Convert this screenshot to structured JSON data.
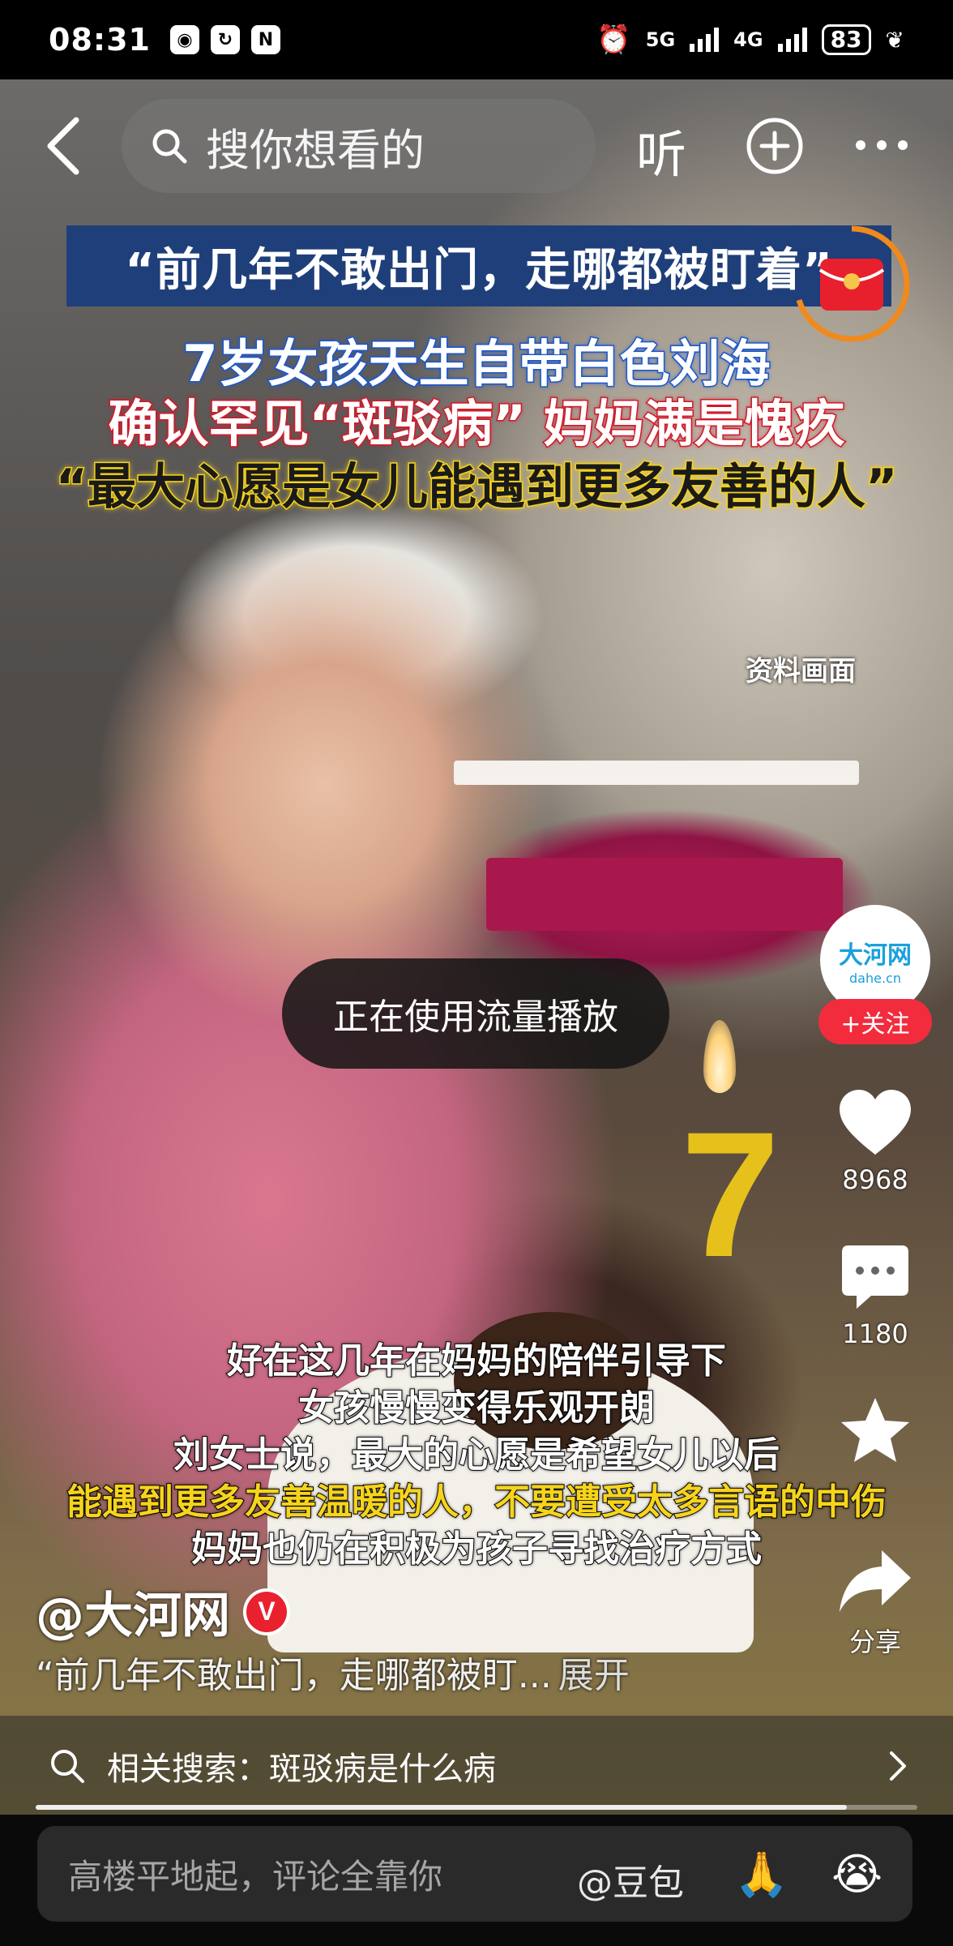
{
  "status": {
    "time": "08:31",
    "network1": "5G",
    "network2": "4G",
    "battery": "83"
  },
  "nav": {
    "search_placeholder": "搜你想看的",
    "listen_label": "听"
  },
  "overlay": {
    "headline": "“前几年不敢出门，走哪都被盯着”",
    "line1": "7岁女孩天生自带白色刘海",
    "line2": "确认罕见“斑驳病” 妈妈满是愧疚",
    "line3": "“最大心愿是女儿能遇到更多友善的人”",
    "source": "资料画面",
    "candle_number": "7"
  },
  "toast": "正在使用流量播放",
  "rail": {
    "avatar_logo": "大河网",
    "avatar_sub": "dahe.cn",
    "follow_label": "+关注",
    "likes": "8968",
    "comments": "1180",
    "share_label": "分享"
  },
  "subtitles": [
    "好在这几年在妈妈的陪伴引导下",
    "女孩慢慢变得乐观开朗",
    "刘女士说，最大的心愿是希望女儿以后",
    "能遇到更多友善温暖的人，不要遭受太多言语的中伤",
    "妈妈也仍在积极为孩子寻找治疗方式"
  ],
  "author": {
    "name": "@大河网",
    "verify": "V"
  },
  "description": {
    "text": "“前几年不敢出门，走哪都被盯...",
    "expand": "展开"
  },
  "related": {
    "text": "相关搜索：斑驳病是什么病"
  },
  "progress_fraction": 0.92,
  "comment_bar": {
    "placeholder": "高楼平地起，评论全靠你",
    "mention": "@豆包",
    "emoji1": "🙏",
    "emoji2": "😭"
  },
  "colors": {
    "follow": "#f22c3d",
    "headline_bg": "#1f3f7a",
    "highlight_yellow": "#f6d41c"
  }
}
